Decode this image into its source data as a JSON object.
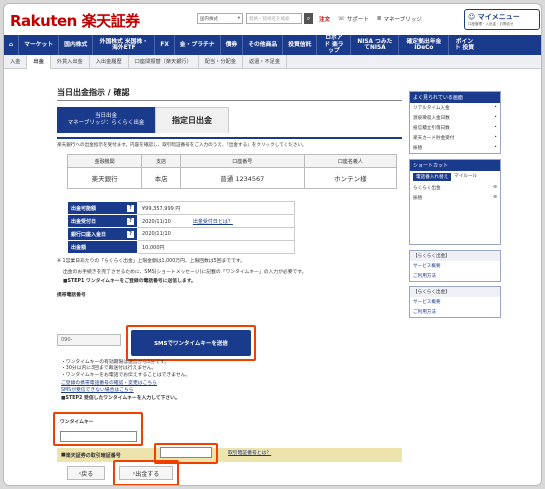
{
  "header": {
    "logo": "Rakuten 楽天証券",
    "market_select": "国内株式",
    "search_placeholder": "銘柄・銘柄名を検索",
    "links": [
      "注文",
      "サポート",
      "マネーブリッジ"
    ],
    "mymenu": "マイメニュー",
    "mymenu_sub": "口座管理・入出金・お問合せ"
  },
  "nav": [
    "マーケット",
    "国内株式",
    "外国株式 米国株・海外ETF",
    "FX",
    "金・プラチナ",
    "債券",
    "その他商品",
    "投資信託",
    "ロボアド 楽ラップ",
    "NISA つみたてNISA",
    "確定拠出年金 iDeCo",
    "ポイント 投資"
  ],
  "subnav": [
    "入金",
    "出金",
    "外貨入出金",
    "入出金履歴",
    "口座間振替（楽天銀行）",
    "配当・分配金",
    "返還・不足金"
  ],
  "page_title": "当日出金指示 / 確認",
  "tabs": {
    "active_line1": "当日出金",
    "active_line2": "マネーブリッジ：らくらく出金",
    "inactive": "指定日出金"
  },
  "intro": "楽天銀行への出金指示を受付ます。内容を確認し、取引暗証番号をご入力のうえ、『出金する』をクリックしてください。",
  "bank_table": {
    "headers": [
      "金融機関",
      "支店",
      "口座番号",
      "口座名義人"
    ],
    "row": [
      "楽天銀行",
      "本店",
      "普通 1234567",
      "ホンテン様"
    ]
  },
  "details": [
    {
      "label": "出金可能額",
      "value": "¥99,357,999 円",
      "link": ""
    },
    {
      "label": "出金受付日",
      "value": "2020/11/10",
      "link": "出金受付日とは？"
    },
    {
      "label": "銀行口座入金日",
      "value": "2020/11/10",
      "link": ""
    },
    {
      "label": "出金額",
      "value": "10,000円",
      "link": ""
    }
  ],
  "note1": "※ 1営業日あたりの「らくらく出金」上限金額は1,000万円、上限回数は5回までです。",
  "note2": "出金のお手続きを完了させるために、SMS(ショートメッセージ)に記載の「ワンタイムキー」の入力が必要です。",
  "step1": "■STEP1 ワンタイムキーをご登録の電話番号に送信します。",
  "phone_label": "携帯電話番号",
  "phone_value": "090-",
  "sms_button": "SMSでワンタイムキーを送信",
  "bullets": [
    "・ワンタイムキーの有効期限は送信から5分です。",
    "・30分以内に3回まで再送付は行えません。",
    "・ワンタイムキーをお電話でお伝えすることはできません。"
  ],
  "links": [
    "ご登録の携帯電話番号の確認・変更はこちら",
    "SMSが受信できない場合はこちら"
  ],
  "step2": "■STEP2 受信したワンタイムキーを入力して下さい。",
  "otp_label": "ワンタイムキー",
  "pw_label": "楽天証券の取引暗証番号",
  "pw_link": "取引暗証番号とは？",
  "back_button": "戻る",
  "submit_button": "出金する",
  "sidebar": {
    "faq_title": "よく見られている画面",
    "faq_items": [
      "リアルタイム入金",
      "源泉徴収入金日数",
      "投信積立引落日数",
      "楽天カード貯金受付",
      "振替"
    ],
    "shortcut_title": "ショートカット",
    "shortcut_tabs": [
      "電話番入れ替え",
      "マイルール"
    ],
    "shortcut_items": [
      "らくらく出金",
      "振替"
    ],
    "cards": [
      {
        "title": "【らくらく出金】",
        "items": [
          "サービス概要",
          "ご利用方法"
        ]
      },
      {
        "title": "【らくらく出金】",
        "items": [
          "サービス概要",
          "ご利用方法"
        ]
      }
    ]
  },
  "colors": {
    "brand_red": "#bf0000",
    "nav_blue": "#1a3a8c",
    "highlight": "#f04000",
    "pw_bar": "#ede3ad"
  }
}
